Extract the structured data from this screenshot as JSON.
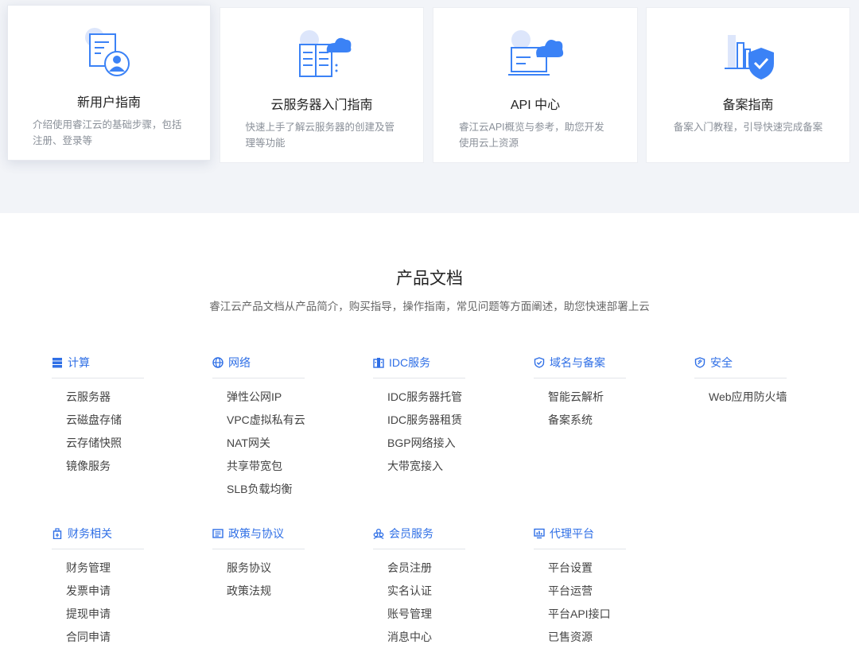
{
  "cards": [
    {
      "title": "新用户指南",
      "desc": "介绍使用睿江云的基础步骤，包括注册、登录等",
      "icon": "user-guide-icon"
    },
    {
      "title": "云服务器入门指南",
      "desc": "快速上手了解云服务器的创建及管理等功能",
      "icon": "cloud-server-icon"
    },
    {
      "title": "API 中心",
      "desc": "睿江云API概览与参考，助您开发使用云上资源",
      "icon": "api-cloud-icon"
    },
    {
      "title": "备案指南",
      "desc": "备案入门教程，引导快速完成备案",
      "icon": "shield-check-icon"
    }
  ],
  "section": {
    "title": "产品文档",
    "subtitle": "睿江云产品文档从产品简介，购买指导，操作指南，常见问题等方面阐述，助您快速部署上云"
  },
  "categories": [
    {
      "name": "计算",
      "icon": "server-icon",
      "items": [
        "云服务器",
        "云磁盘存储",
        "云存储快照",
        "镜像服务"
      ]
    },
    {
      "name": "网络",
      "icon": "globe-icon",
      "items": [
        "弹性公网IP",
        "VPC虚拟私有云",
        "NAT网关",
        "共享带宽包",
        "SLB负载均衡"
      ]
    },
    {
      "name": "IDC服务",
      "icon": "building-icon",
      "items": [
        "IDC服务器托管",
        "IDC服务器租赁",
        "BGP网络接入",
        "大带宽接入"
      ]
    },
    {
      "name": "域名与备案",
      "icon": "shield-icon",
      "items": [
        "智能云解析",
        "备案系统"
      ]
    },
    {
      "name": "安全",
      "icon": "security-icon",
      "items": [
        "Web应用防火墙"
      ]
    },
    {
      "name": "财务相关",
      "icon": "finance-icon",
      "items": [
        "财务管理",
        "发票申请",
        "提现申请",
        "合同申请"
      ]
    },
    {
      "name": "政策与协议",
      "icon": "document-icon",
      "items": [
        "服务协议",
        "政策法规"
      ]
    },
    {
      "name": "会员服务",
      "icon": "members-icon",
      "items": [
        "会员注册",
        "实名认证",
        "账号管理",
        "消息中心"
      ]
    },
    {
      "name": "代理平台",
      "icon": "monitor-icon",
      "items": [
        "平台设置",
        "平台运营",
        "平台API接口",
        "已售资源"
      ]
    }
  ],
  "colors": {
    "accent": "#2f6fe6",
    "icon_blue": "#3b82f6",
    "icon_light": "#c9d8fb"
  }
}
